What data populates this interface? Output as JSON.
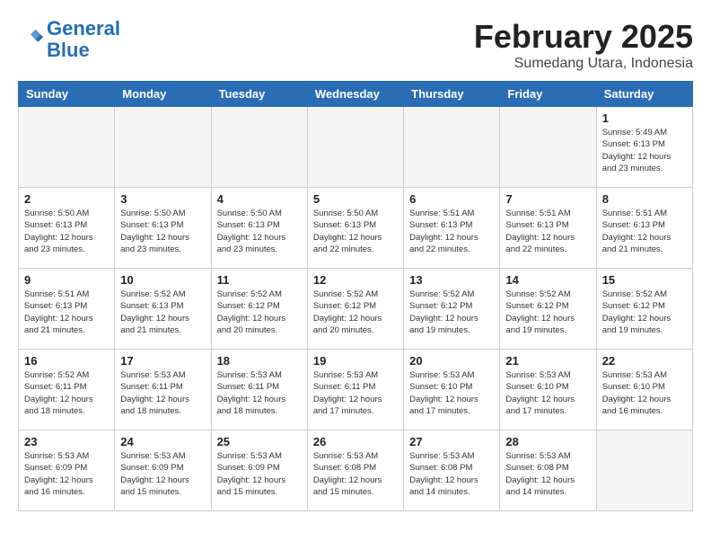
{
  "header": {
    "logo_line1": "General",
    "logo_line2": "Blue",
    "month": "February 2025",
    "location": "Sumedang Utara, Indonesia"
  },
  "days_of_week": [
    "Sunday",
    "Monday",
    "Tuesday",
    "Wednesday",
    "Thursday",
    "Friday",
    "Saturday"
  ],
  "weeks": [
    [
      {
        "day": "",
        "info": ""
      },
      {
        "day": "",
        "info": ""
      },
      {
        "day": "",
        "info": ""
      },
      {
        "day": "",
        "info": ""
      },
      {
        "day": "",
        "info": ""
      },
      {
        "day": "",
        "info": ""
      },
      {
        "day": "1",
        "info": "Sunrise: 5:49 AM\nSunset: 6:13 PM\nDaylight: 12 hours\nand 23 minutes."
      }
    ],
    [
      {
        "day": "2",
        "info": "Sunrise: 5:50 AM\nSunset: 6:13 PM\nDaylight: 12 hours\nand 23 minutes."
      },
      {
        "day": "3",
        "info": "Sunrise: 5:50 AM\nSunset: 6:13 PM\nDaylight: 12 hours\nand 23 minutes."
      },
      {
        "day": "4",
        "info": "Sunrise: 5:50 AM\nSunset: 6:13 PM\nDaylight: 12 hours\nand 23 minutes."
      },
      {
        "day": "5",
        "info": "Sunrise: 5:50 AM\nSunset: 6:13 PM\nDaylight: 12 hours\nand 22 minutes."
      },
      {
        "day": "6",
        "info": "Sunrise: 5:51 AM\nSunset: 6:13 PM\nDaylight: 12 hours\nand 22 minutes."
      },
      {
        "day": "7",
        "info": "Sunrise: 5:51 AM\nSunset: 6:13 PM\nDaylight: 12 hours\nand 22 minutes."
      },
      {
        "day": "8",
        "info": "Sunrise: 5:51 AM\nSunset: 6:13 PM\nDaylight: 12 hours\nand 21 minutes."
      }
    ],
    [
      {
        "day": "9",
        "info": "Sunrise: 5:51 AM\nSunset: 6:13 PM\nDaylight: 12 hours\nand 21 minutes."
      },
      {
        "day": "10",
        "info": "Sunrise: 5:52 AM\nSunset: 6:13 PM\nDaylight: 12 hours\nand 21 minutes."
      },
      {
        "day": "11",
        "info": "Sunrise: 5:52 AM\nSunset: 6:12 PM\nDaylight: 12 hours\nand 20 minutes."
      },
      {
        "day": "12",
        "info": "Sunrise: 5:52 AM\nSunset: 6:12 PM\nDaylight: 12 hours\nand 20 minutes."
      },
      {
        "day": "13",
        "info": "Sunrise: 5:52 AM\nSunset: 6:12 PM\nDaylight: 12 hours\nand 19 minutes."
      },
      {
        "day": "14",
        "info": "Sunrise: 5:52 AM\nSunset: 6:12 PM\nDaylight: 12 hours\nand 19 minutes."
      },
      {
        "day": "15",
        "info": "Sunrise: 5:52 AM\nSunset: 6:12 PM\nDaylight: 12 hours\nand 19 minutes."
      }
    ],
    [
      {
        "day": "16",
        "info": "Sunrise: 5:52 AM\nSunset: 6:11 PM\nDaylight: 12 hours\nand 18 minutes."
      },
      {
        "day": "17",
        "info": "Sunrise: 5:53 AM\nSunset: 6:11 PM\nDaylight: 12 hours\nand 18 minutes."
      },
      {
        "day": "18",
        "info": "Sunrise: 5:53 AM\nSunset: 6:11 PM\nDaylight: 12 hours\nand 18 minutes."
      },
      {
        "day": "19",
        "info": "Sunrise: 5:53 AM\nSunset: 6:11 PM\nDaylight: 12 hours\nand 17 minutes."
      },
      {
        "day": "20",
        "info": "Sunrise: 5:53 AM\nSunset: 6:10 PM\nDaylight: 12 hours\nand 17 minutes."
      },
      {
        "day": "21",
        "info": "Sunrise: 5:53 AM\nSunset: 6:10 PM\nDaylight: 12 hours\nand 17 minutes."
      },
      {
        "day": "22",
        "info": "Sunrise: 5:53 AM\nSunset: 6:10 PM\nDaylight: 12 hours\nand 16 minutes."
      }
    ],
    [
      {
        "day": "23",
        "info": "Sunrise: 5:53 AM\nSunset: 6:09 PM\nDaylight: 12 hours\nand 16 minutes."
      },
      {
        "day": "24",
        "info": "Sunrise: 5:53 AM\nSunset: 6:09 PM\nDaylight: 12 hours\nand 15 minutes."
      },
      {
        "day": "25",
        "info": "Sunrise: 5:53 AM\nSunset: 6:09 PM\nDaylight: 12 hours\nand 15 minutes."
      },
      {
        "day": "26",
        "info": "Sunrise: 5:53 AM\nSunset: 6:08 PM\nDaylight: 12 hours\nand 15 minutes."
      },
      {
        "day": "27",
        "info": "Sunrise: 5:53 AM\nSunset: 6:08 PM\nDaylight: 12 hours\nand 14 minutes."
      },
      {
        "day": "28",
        "info": "Sunrise: 5:53 AM\nSunset: 6:08 PM\nDaylight: 12 hours\nand 14 minutes."
      },
      {
        "day": "",
        "info": ""
      }
    ]
  ]
}
